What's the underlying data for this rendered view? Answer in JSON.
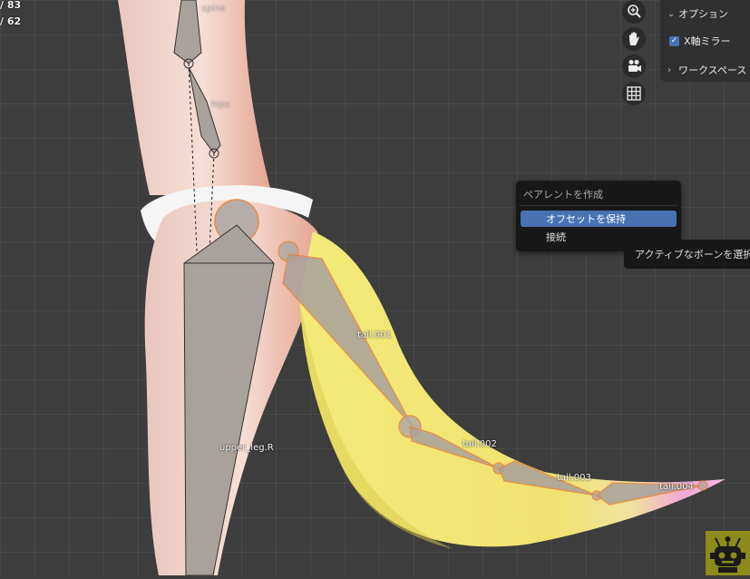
{
  "stats": {
    "line1": "/ 83",
    "line2": "/ 62"
  },
  "navigation": {
    "zoom_icon": "zoom-magnifier-icon",
    "pan_icon": "hand-icon",
    "camera_icon": "camera-icon",
    "grid_icon": "grid-icon"
  },
  "options_panel": {
    "options_label": "オプション",
    "x_mirror_label": "X軸ミラー",
    "x_mirror_checked": true,
    "workspace_label": "ワークスペース"
  },
  "parent_menu": {
    "title": "ペアレントを作成",
    "items": [
      {
        "label": "オフセットを保持",
        "active": true
      },
      {
        "label": "接続",
        "active": false
      }
    ]
  },
  "tooltip": {
    "text": "アクティブなボーンを選択"
  },
  "bones": {
    "spine": "spine",
    "hips": "hips",
    "tail_001": "tail.001",
    "tail_002": "tail.002",
    "tail_003": "tail.003",
    "tail_004": "tail.004",
    "upper_leg": "upper_leg.R"
  },
  "colors": {
    "viewport_bg": "#3d3d3d",
    "selection_orange": "#e8833a",
    "menu_highlight": "#4772b3",
    "tail_yellow": "#f0e577",
    "tail_pink": "#f2a9d8"
  }
}
